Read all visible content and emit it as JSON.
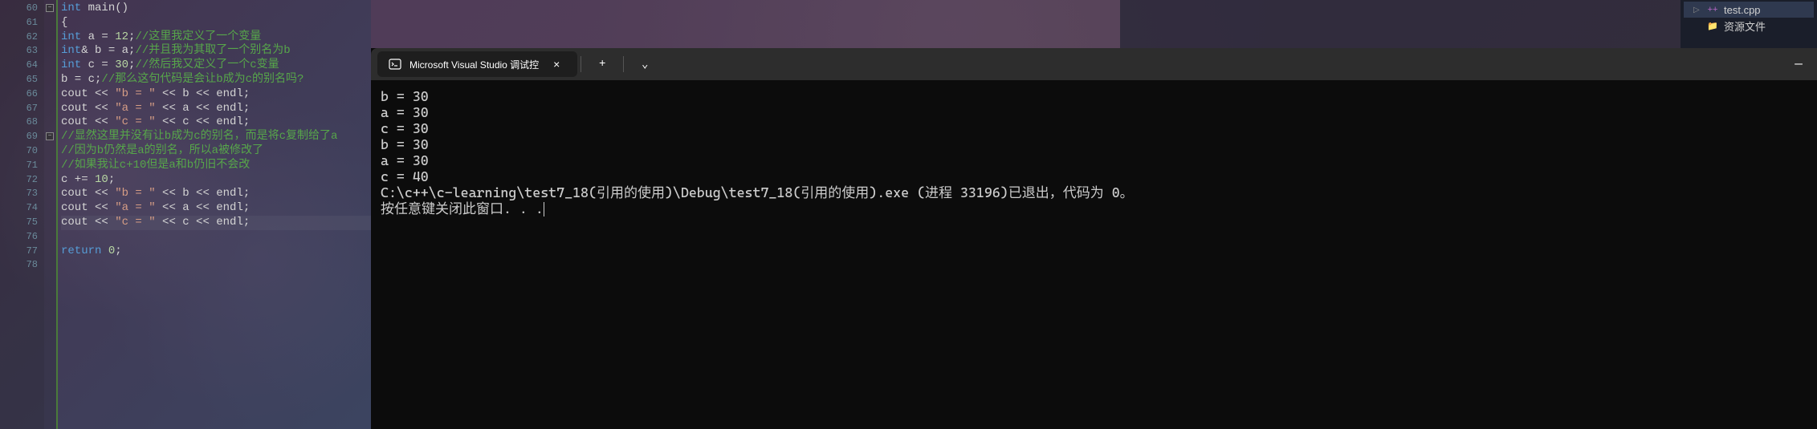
{
  "editor": {
    "line_numbers": [
      "60",
      "61",
      "62",
      "63",
      "64",
      "65",
      "66",
      "67",
      "68",
      "69",
      "70",
      "71",
      "72",
      "73",
      "74",
      "75",
      "76",
      "77",
      "78"
    ],
    "current_line_index": 15,
    "fold_markers": [
      {
        "line_index": 0,
        "symbol": "−"
      },
      {
        "line_index": 9,
        "symbol": "−"
      }
    ],
    "lines": {
      "60": {
        "tokens": [
          {
            "t": "int",
            "c": "kw"
          },
          {
            "t": " main()",
            "c": "id"
          }
        ]
      },
      "61": {
        "tokens": [
          {
            "t": "{",
            "c": "id"
          }
        ]
      },
      "62": {
        "tokens": [
          {
            "t": "    ",
            "c": "id"
          },
          {
            "t": "int",
            "c": "kw"
          },
          {
            "t": " a = ",
            "c": "id"
          },
          {
            "t": "12",
            "c": "num"
          },
          {
            "t": ";",
            "c": "id"
          },
          {
            "t": "//这里我定义了一个变量",
            "c": "cmt"
          }
        ]
      },
      "63": {
        "tokens": [
          {
            "t": "    ",
            "c": "id"
          },
          {
            "t": "int",
            "c": "kw"
          },
          {
            "t": "& b = a;",
            "c": "id"
          },
          {
            "t": "//并且我为其取了一个别名为b",
            "c": "cmt"
          }
        ]
      },
      "64": {
        "tokens": [
          {
            "t": "    ",
            "c": "id"
          },
          {
            "t": "int",
            "c": "kw"
          },
          {
            "t": " c = ",
            "c": "id"
          },
          {
            "t": "30",
            "c": "num"
          },
          {
            "t": ";",
            "c": "id"
          },
          {
            "t": "//然后我又定义了一个c变量",
            "c": "cmt"
          }
        ]
      },
      "65": {
        "tokens": [
          {
            "t": "    b = c;",
            "c": "id"
          },
          {
            "t": "//那么这句代码是会让b成为c的别名吗?",
            "c": "cmt"
          }
        ]
      },
      "66": {
        "tokens": [
          {
            "t": "    cout << ",
            "c": "id"
          },
          {
            "t": "\"b = \"",
            "c": "str"
          },
          {
            "t": " << b << endl;",
            "c": "id"
          }
        ]
      },
      "67": {
        "tokens": [
          {
            "t": "    cout << ",
            "c": "id"
          },
          {
            "t": "\"a = \"",
            "c": "str"
          },
          {
            "t": " << a << endl;",
            "c": "id"
          }
        ]
      },
      "68": {
        "tokens": [
          {
            "t": "    cout << ",
            "c": "id"
          },
          {
            "t": "\"c = \"",
            "c": "str"
          },
          {
            "t": " << c << endl;",
            "c": "id"
          }
        ]
      },
      "69": {
        "tokens": [
          {
            "t": "    ",
            "c": "id"
          },
          {
            "t": "//显然这里并没有让b成为c的别名，而是将c复制给了a",
            "c": "cmt"
          }
        ]
      },
      "70": {
        "tokens": [
          {
            "t": "    ",
            "c": "id"
          },
          {
            "t": "//因为b仍然是a的别名，所以a被修改了",
            "c": "cmt"
          }
        ]
      },
      "71": {
        "tokens": [
          {
            "t": "    ",
            "c": "id"
          },
          {
            "t": "//如果我让c+10但是a和b仍旧不会改",
            "c": "cmt"
          }
        ]
      },
      "72": {
        "tokens": [
          {
            "t": "    c += ",
            "c": "id"
          },
          {
            "t": "10",
            "c": "num"
          },
          {
            "t": ";",
            "c": "id"
          }
        ]
      },
      "73": {
        "tokens": [
          {
            "t": "    cout << ",
            "c": "id"
          },
          {
            "t": "\"b = \"",
            "c": "str"
          },
          {
            "t": " << b << endl;",
            "c": "id"
          }
        ]
      },
      "74": {
        "tokens": [
          {
            "t": "    cout << ",
            "c": "id"
          },
          {
            "t": "\"a = \"",
            "c": "str"
          },
          {
            "t": " << a << endl;",
            "c": "id"
          }
        ]
      },
      "75": {
        "tokens": [
          {
            "t": "    cout << ",
            "c": "id"
          },
          {
            "t": "\"c = \"",
            "c": "str"
          },
          {
            "t": " << c << endl;",
            "c": "id"
          }
        ]
      },
      "76": {
        "tokens": []
      },
      "77": {
        "tokens": [
          {
            "t": "    ",
            "c": "id"
          },
          {
            "t": "return",
            "c": "kw"
          },
          {
            "t": " ",
            "c": "id"
          },
          {
            "t": "0",
            "c": "num"
          },
          {
            "t": ";",
            "c": "id"
          }
        ]
      },
      "78": {
        "tokens": []
      }
    }
  },
  "terminal": {
    "tab_title": "Microsoft Visual Studio 调试控",
    "output": [
      "b = 30",
      "a = 30",
      "c = 30",
      "b = 30",
      "a = 30",
      "c = 40",
      "",
      "C:\\c++\\c-learning\\test7_18(引用的使用)\\Debug\\test7_18(引用的使用).exe (进程 33196)已退出，代码为 0。",
      "按任意键关闭此窗口. . ."
    ],
    "add_tab_symbol": "+",
    "dropdown_symbol": "⌄",
    "close_symbol": "×",
    "minimize_symbol": "—"
  },
  "solution": {
    "items": [
      {
        "label": "test.cpp",
        "icon": "++",
        "icon_color": "#b968c7",
        "expand": "▷"
      },
      {
        "label": "资源文件",
        "icon": "📁",
        "icon_color": "#e6b422",
        "expand": ""
      }
    ]
  }
}
